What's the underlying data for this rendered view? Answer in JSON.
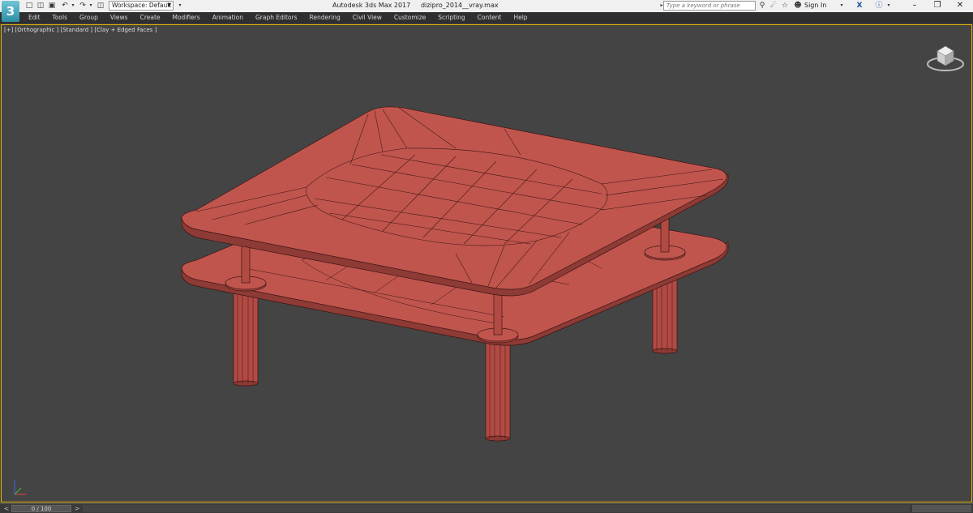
{
  "titlebar": {
    "workspace": "Workspace: Default",
    "window_title": "Autodesk 3ds Max 2017     dizipro_2014__vray.max",
    "search_placeholder": "Type a keyword or phrase",
    "sign_in": "Sign In"
  },
  "menus": [
    "Edit",
    "Tools",
    "Group",
    "Views",
    "Create",
    "Modifiers",
    "Animation",
    "Graph Editors",
    "Rendering",
    "Civil View",
    "Customize",
    "Scripting",
    "Content",
    "Help"
  ],
  "viewport": {
    "label": "[+] [Orthographic ] [Standard ] [Clay + Edged Faces ]"
  },
  "timeline": {
    "frame": "0 / 100",
    "prev": "<",
    "next": ">"
  },
  "icons": {
    "logo": "3",
    "new": "new-file-icon",
    "open": "open-folder-icon",
    "save": "save-icon",
    "undo": "undo-icon",
    "redo": "redo-icon"
  },
  "colors": {
    "model": "#c0554e",
    "edges": "#3a1512",
    "viewport_bg": "#444444",
    "active_border": "#e2b400"
  }
}
